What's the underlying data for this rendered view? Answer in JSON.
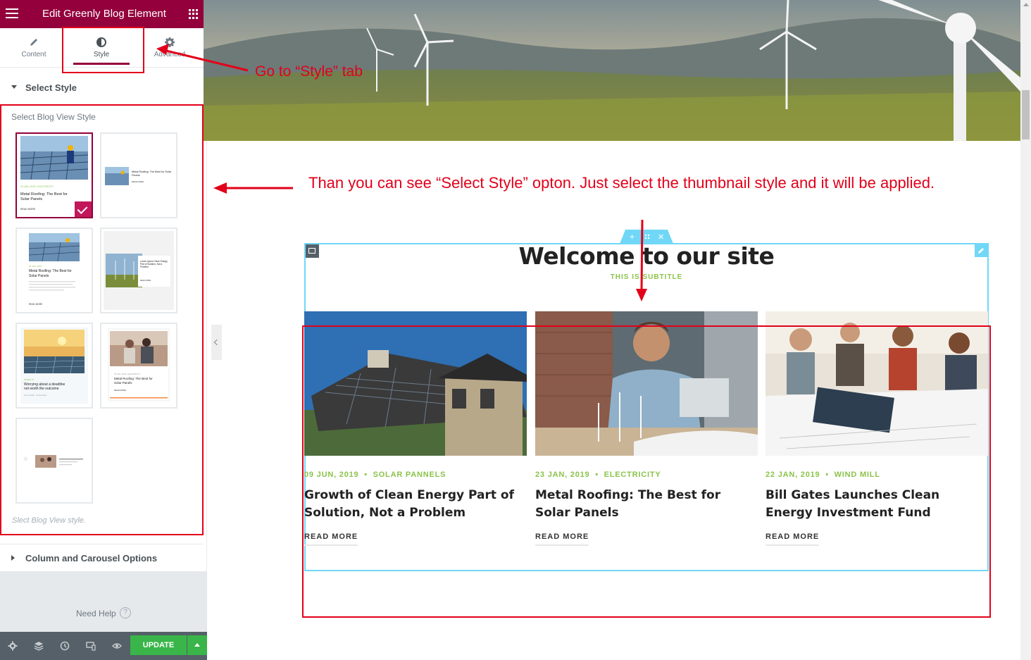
{
  "panel": {
    "title": "Edit Greenly Blog Element",
    "tabs": [
      {
        "label": "Content",
        "icon": "pencil-icon"
      },
      {
        "label": "Style",
        "icon": "contrast-icon"
      },
      {
        "label": "Advanced",
        "icon": "gear-icon"
      }
    ],
    "select_style_section": "Select Style",
    "style_control_heading": "Select Blog View Style",
    "style_control_description": "Slect Blog View style.",
    "style_options": [
      {
        "selected": true,
        "thumb_title": "Metal Roofing: The Best for Solar Panels",
        "thumb_read_more": "READ MORE"
      },
      {
        "selected": false,
        "thumb_title": "Metal Roofing: The Best for Solar Panels"
      },
      {
        "selected": false,
        "thumb_title": "Metal Roofing: The Best for Solar Panels"
      },
      {
        "selected": false,
        "thumb_title": "Lorem Ipsum Clean Energy Part of Solution Not a Problem"
      },
      {
        "selected": false,
        "thumb_title": "Worrying about a deadline not worth the outcome"
      },
      {
        "selected": false,
        "thumb_title": "Metal Roofing: The Best for Solar Panels"
      },
      {
        "selected": false,
        "thumb_title": ""
      }
    ],
    "column_section": "Column and Carousel Options",
    "help_label": "Need Help",
    "update_label": "UPDATE",
    "footer_icons": [
      "settings-icon",
      "layers-icon",
      "history-icon",
      "responsive-icon",
      "preview-eye-icon"
    ]
  },
  "preview": {
    "title": "Welcome to our site",
    "subtitle": "THIS IS SUBTITLE",
    "posts": [
      {
        "date": "09 JUN, 2019",
        "category": "SOLAR PANNELS",
        "title": "Growth of Clean Energy Part of Solution, Not a Problem",
        "read_more": "READ MORE"
      },
      {
        "date": "23 JAN, 2019",
        "category": "ELECTRICITY",
        "title": "Metal Roofing: The Best for Solar Panels",
        "read_more": "READ MORE"
      },
      {
        "date": "22 JAN, 2019",
        "category": "WIND MILL",
        "title": "Bill Gates Launches Clean Energy Investment Fund",
        "read_more": "READ MORE"
      }
    ]
  },
  "annotations": {
    "style_tab_note": "Go  to “Style” tab",
    "select_style_note": "Than you  can see “Select Style” opton. Just select the thumbnail style and it will be applied."
  },
  "colors": {
    "brand": "#93003c",
    "accent_green": "#8bc34a",
    "update_green": "#39b54a",
    "annotation_red": "#e2001a",
    "section_outline": "#71d7f7"
  }
}
